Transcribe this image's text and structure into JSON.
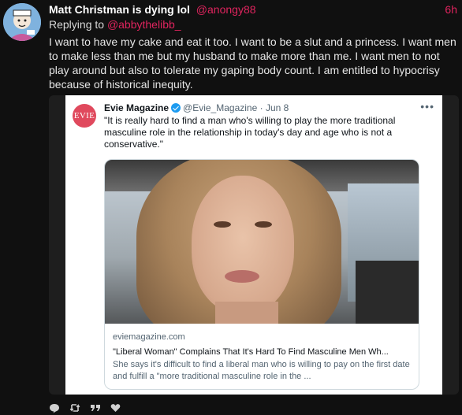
{
  "post": {
    "author": "Matt Christman is dying lol",
    "handle": "@anongy88",
    "time": "6h",
    "reply_prefix": "Replying to",
    "reply_to": "@abbythelibb_",
    "text": "I want to have my cake and eat it too. I want to be a slut and a princess. I want men to make less than me but my husband to make more than me. I want men to not play around but also to tolerate my gaping body count. I am entitled to hypocrisy because of historical inequity."
  },
  "embed": {
    "logo_text": "EVIE",
    "name": "Evie Magazine",
    "handle": "@Evie_Magazine",
    "sep": "·",
    "date": "Jun 8",
    "menu": "•••",
    "quote": "\"It is really hard to find a man who's willing to play the more traditional masculine role in the relationship in today's day and age who is not a conservative.\"",
    "link": {
      "domain": "eviemagazine.com",
      "title": "\"Liberal Woman\" Complains That It's Hard To Find Masculine Men Wh...",
      "description": "She says it's difficult to find a liberal man who is willing to pay on the first date and fulfill a \"more traditional masculine role in the ..."
    }
  },
  "actions": {
    "reply_icon": "comment-icon",
    "repost_icon": "repost-icon",
    "quote_icon": "quote-icon",
    "like_icon": "heart-icon"
  },
  "colors": {
    "accent": "#e0245e",
    "background": "#101010",
    "verified": "#1d9bf0",
    "evie_brand": "#e0495d"
  }
}
